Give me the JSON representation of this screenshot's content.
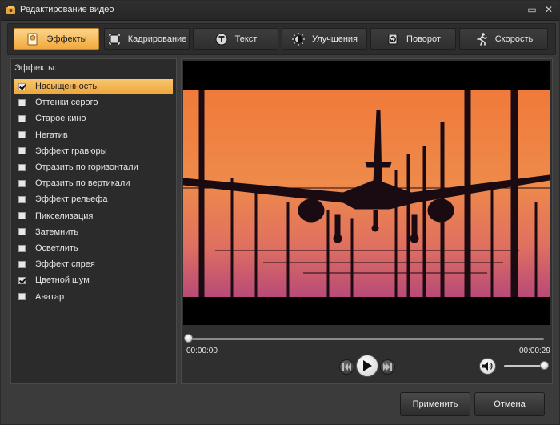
{
  "window": {
    "title": "Редактирование видео",
    "minimize_glyph": "▭",
    "close_glyph": "✕"
  },
  "tabs": [
    {
      "label": "Эффекты",
      "icon": "effects-icon",
      "active": true
    },
    {
      "label": "Кадрирование",
      "icon": "crop-icon",
      "active": false
    },
    {
      "label": "Текст",
      "icon": "text-icon",
      "active": false
    },
    {
      "label": "Улучшения",
      "icon": "brightness-icon",
      "active": false
    },
    {
      "label": "Поворот",
      "icon": "rotate-icon",
      "active": false
    },
    {
      "label": "Скорость",
      "icon": "running-man-icon",
      "active": false
    }
  ],
  "effects_panel": {
    "title": "Эффекты:",
    "items": [
      {
        "label": "Насыщенность",
        "checked": true,
        "selected": true
      },
      {
        "label": "Оттенки серого",
        "checked": false,
        "selected": false
      },
      {
        "label": "Старое кино",
        "checked": false,
        "selected": false
      },
      {
        "label": "Негатив",
        "checked": false,
        "selected": false
      },
      {
        "label": "Эффект гравюры",
        "checked": false,
        "selected": false
      },
      {
        "label": "Отразить по горизонтали",
        "checked": false,
        "selected": false
      },
      {
        "label": "Отразить по вертикали",
        "checked": false,
        "selected": false
      },
      {
        "label": "Эффект рельефа",
        "checked": false,
        "selected": false
      },
      {
        "label": "Пикселизация",
        "checked": false,
        "selected": false
      },
      {
        "label": "Затемнить",
        "checked": false,
        "selected": false
      },
      {
        "label": "Осветлить",
        "checked": false,
        "selected": false
      },
      {
        "label": "Эффект спрея",
        "checked": false,
        "selected": false
      },
      {
        "label": "Цветной шум",
        "checked": true,
        "selected": false
      },
      {
        "label": "Аватар",
        "checked": false,
        "selected": false
      }
    ]
  },
  "player": {
    "current_time": "00:00:00",
    "total_time": "00:00:29",
    "progress_fraction": 0.0,
    "volume_fraction": 1.0
  },
  "buttons": {
    "apply": "Применить",
    "cancel": "Отмена"
  },
  "colors": {
    "active_tab": "#f2a93c",
    "sky_top": "#f07a3a",
    "sky_bottom": "#c9507a"
  }
}
